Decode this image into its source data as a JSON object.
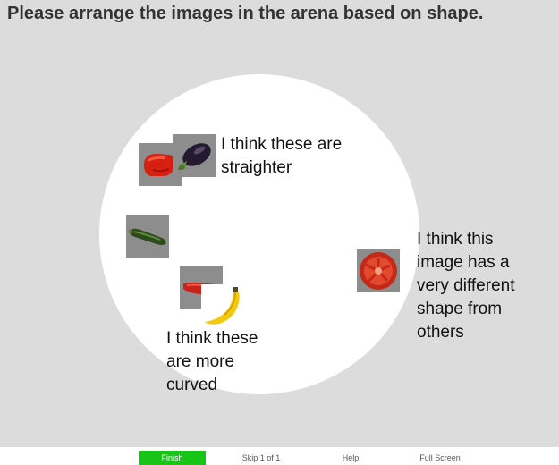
{
  "instruction": "Please arrange the images in the arena based on shape.",
  "arena": {
    "items": [
      {
        "name": "red-pepper-image",
        "icon": "red-bell-pepper"
      },
      {
        "name": "eggplant-image",
        "icon": "eggplant"
      },
      {
        "name": "zucchini-image",
        "icon": "zucchini"
      },
      {
        "name": "red-chili-image",
        "icon": "red-chili-pepper"
      },
      {
        "name": "banana-image",
        "icon": "banana"
      },
      {
        "name": "tomato-image",
        "icon": "tomato-slice"
      }
    ],
    "annotations": {
      "straighter": "I think these are\nstraighter",
      "different": "I think this\nimage has a\nvery different\nshape from\nothers",
      "curved": "I think these\nare more\ncurved"
    }
  },
  "footer": {
    "finish_label": "Finish",
    "skip_label": "Skip 1 of 1",
    "help_label": "Help",
    "fullscreen_label": "Full Screen"
  },
  "colors": {
    "background": "#dcdcdc",
    "arena": "#ffffff",
    "finish_button": "#18c418"
  }
}
